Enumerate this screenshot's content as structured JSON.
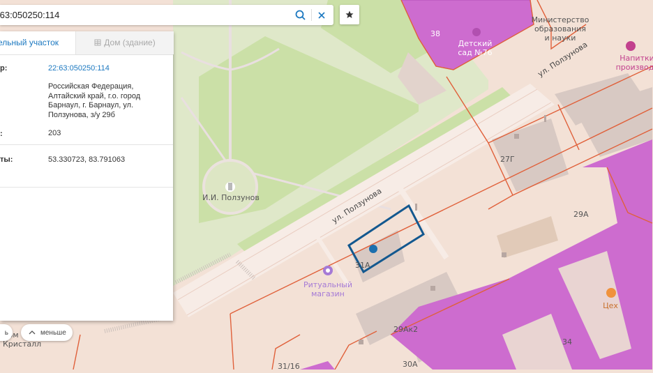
{
  "search": {
    "value": ":63:050250:114"
  },
  "panel": {
    "tabs": [
      {
        "label": "ельный участок"
      },
      {
        "label": "Дом (здание)"
      }
    ],
    "rows": [
      {
        "label": "р:",
        "value": "22:63:050250:114"
      },
      {
        "label": "",
        "value": "Российская Федерация, Алтайский край, г.о. город Барнаул, г. Барнаул, ул. Ползунова, з/у 29б"
      },
      {
        "label": ":",
        "value": "203"
      },
      {
        "label": "ты:",
        "value": "53.330723, 83.791063"
      }
    ]
  },
  "zoom": {
    "more_label": "ь",
    "less_label": "меньше"
  },
  "map": {
    "labels": {
      "ministry": "Министерство\nобразования\nи науки",
      "kindergarten": "Детский\nсад №76",
      "drinks": "Напитки\nпроизводс",
      "polzunov": "И.И. Ползунов",
      "ritual": "Ритуальный\nмагазин",
      "ceh": "Цех",
      "kristall": "дом\nКристалл",
      "h38": "38",
      "h27g": "27Г",
      "h29a": "29А",
      "h31a": "31А",
      "h29ak2": "29Ак2",
      "h34": "34",
      "h3116": "31/16",
      "h30a": "30А"
    },
    "streets": {
      "polzunova": "ул. Ползунова"
    },
    "marker_color": "#1b6fae",
    "parcel_color": "#13588f",
    "zone_color": "#d45ccc",
    "boundary_color": "#e0603a"
  }
}
